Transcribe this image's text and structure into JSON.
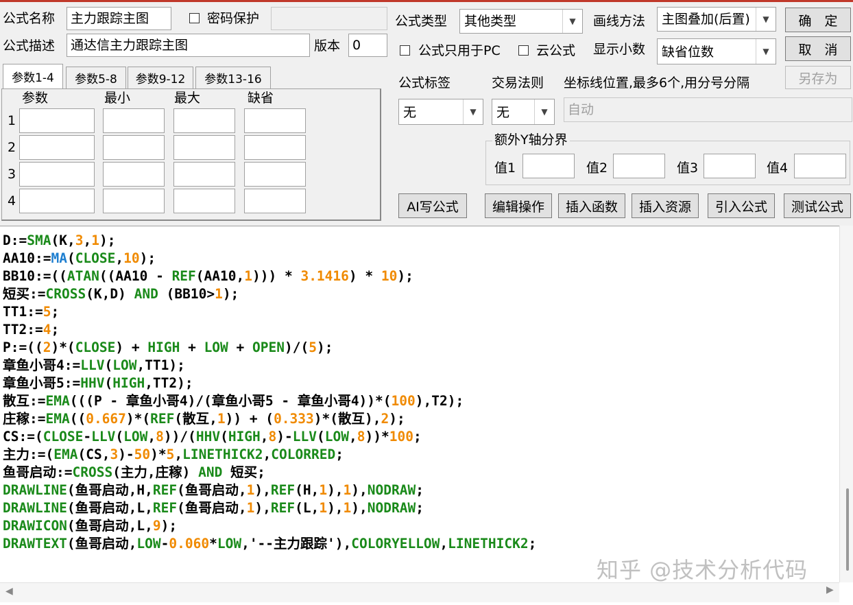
{
  "labels": {
    "formula_name": "公式名称",
    "password": "密码保护",
    "formula_desc": "公式描述",
    "version": "版本",
    "formula_type": "公式类型",
    "draw_method": "画线方法",
    "pc_only": "公式只用于PC",
    "cloud": "云公式",
    "show_decimal": "显示小数",
    "formula_tag": "公式标签",
    "trade_rule": "交易法则",
    "coord_lines": "坐标线位置,最多6个,用分号分隔",
    "extra_y": "额外Y轴分界",
    "v1": "值1",
    "v2": "值2",
    "v3": "值3",
    "v4": "值4"
  },
  "fields": {
    "formula_name": "主力跟踪主图",
    "password": "",
    "formula_desc": "通达信主力跟踪主图",
    "version": "0",
    "formula_type": "其他类型",
    "draw_method": "主图叠加(后置)",
    "show_decimal": "缺省位数",
    "formula_tag": "无",
    "trade_rule": "无",
    "coord_lines": "自动"
  },
  "buttons": {
    "ok": "确　定",
    "cancel": "取　消",
    "save_as": "另存为",
    "ai": "AI写公式",
    "edit": "编辑操作",
    "insert_func": "插入函数",
    "insert_res": "插入资源",
    "import": "引入公式",
    "test": "测试公式"
  },
  "tabs": [
    "参数1-4",
    "参数5-8",
    "参数9-12",
    "参数13-16"
  ],
  "param_headers": [
    "参数",
    "最小",
    "最大",
    "缺省"
  ],
  "param_rows": [
    "1",
    "2",
    "3",
    "4"
  ],
  "colors": {
    "green": "#1a8a1a",
    "orange": "#f08a00",
    "blue": "#1f7fd0",
    "black": "#000000"
  },
  "code_lines": [
    [
      [
        "D:=",
        "k"
      ],
      [
        "SMA",
        "g"
      ],
      [
        "(K,",
        "k"
      ],
      [
        "3",
        "o"
      ],
      [
        ",",
        "k"
      ],
      [
        "1",
        "o"
      ],
      [
        ");",
        "k"
      ]
    ],
    [
      [
        "AA10:=",
        "k"
      ],
      [
        "MA",
        "b"
      ],
      [
        "(",
        "k"
      ],
      [
        "CLOSE",
        "g"
      ],
      [
        ",",
        "k"
      ],
      [
        "10",
        "o"
      ],
      [
        ");",
        "k"
      ]
    ],
    [
      [
        "BB10:=((",
        "k"
      ],
      [
        "ATAN",
        "g"
      ],
      [
        "((AA10 - ",
        "k"
      ],
      [
        "REF",
        "g"
      ],
      [
        "(AA10,",
        "k"
      ],
      [
        "1",
        "o"
      ],
      [
        "))) * ",
        "k"
      ],
      [
        "3.1416",
        "o"
      ],
      [
        ") * ",
        "k"
      ],
      [
        "10",
        "o"
      ],
      [
        ");",
        "k"
      ]
    ],
    [
      [
        "短买:=",
        "k"
      ],
      [
        "CROSS",
        "g"
      ],
      [
        "(K,D) ",
        "k"
      ],
      [
        "AND",
        "g"
      ],
      [
        " (BB10>",
        "k"
      ],
      [
        "1",
        "o"
      ],
      [
        ");",
        "k"
      ]
    ],
    [
      [
        "TT1:=",
        "k"
      ],
      [
        "5",
        "o"
      ],
      [
        ";",
        "k"
      ]
    ],
    [
      [
        "TT2:=",
        "k"
      ],
      [
        "4",
        "o"
      ],
      [
        ";",
        "k"
      ]
    ],
    [
      [
        "P:=((",
        "k"
      ],
      [
        "2",
        "o"
      ],
      [
        ")*(",
        "k"
      ],
      [
        "CLOSE",
        "g"
      ],
      [
        ") + ",
        "k"
      ],
      [
        "HIGH",
        "g"
      ],
      [
        " + ",
        "k"
      ],
      [
        "LOW",
        "g"
      ],
      [
        " + ",
        "k"
      ],
      [
        "OPEN",
        "g"
      ],
      [
        ")/(",
        "k"
      ],
      [
        "5",
        "o"
      ],
      [
        ");",
        "k"
      ]
    ],
    [
      [
        "章鱼小哥4:=",
        "k"
      ],
      [
        "LLV",
        "g"
      ],
      [
        "(",
        "k"
      ],
      [
        "LOW",
        "g"
      ],
      [
        ",TT1);",
        "k"
      ]
    ],
    [
      [
        "章鱼小哥5:=",
        "k"
      ],
      [
        "HHV",
        "g"
      ],
      [
        "(",
        "k"
      ],
      [
        "HIGH",
        "g"
      ],
      [
        ",TT2);",
        "k"
      ]
    ],
    [
      [
        "散互:=",
        "k"
      ],
      [
        "EMA",
        "g"
      ],
      [
        "(((P - 章鱼小哥4)/(章鱼小哥5 - 章鱼小哥4))*(",
        "k"
      ],
      [
        "100",
        "o"
      ],
      [
        "),T2);",
        "k"
      ]
    ],
    [
      [
        "庄稼:=",
        "k"
      ],
      [
        "EMA",
        "g"
      ],
      [
        "((",
        "k"
      ],
      [
        "0.667",
        "o"
      ],
      [
        ")*(",
        "k"
      ],
      [
        "REF",
        "g"
      ],
      [
        "(散互,",
        "k"
      ],
      [
        "1",
        "o"
      ],
      [
        ")) + (",
        "k"
      ],
      [
        "0.333",
        "o"
      ],
      [
        ")*(散互),",
        "k"
      ],
      [
        "2",
        "o"
      ],
      [
        ");",
        "k"
      ]
    ],
    [
      [
        "CS:=(",
        "k"
      ],
      [
        "CLOSE",
        "g"
      ],
      [
        "-",
        "k"
      ],
      [
        "LLV",
        "g"
      ],
      [
        "(",
        "k"
      ],
      [
        "LOW",
        "g"
      ],
      [
        ",",
        "k"
      ],
      [
        "8",
        "o"
      ],
      [
        "))/(",
        "k"
      ],
      [
        "HHV",
        "g"
      ],
      [
        "(",
        "k"
      ],
      [
        "HIGH",
        "g"
      ],
      [
        ",",
        "k"
      ],
      [
        "8",
        "o"
      ],
      [
        ")-",
        "k"
      ],
      [
        "LLV",
        "g"
      ],
      [
        "(",
        "k"
      ],
      [
        "LOW",
        "g"
      ],
      [
        ",",
        "k"
      ],
      [
        "8",
        "o"
      ],
      [
        "))*",
        "k"
      ],
      [
        "100",
        "o"
      ],
      [
        ";",
        "k"
      ]
    ],
    [
      [
        "主力:=(",
        "k"
      ],
      [
        "EMA",
        "g"
      ],
      [
        "(CS,",
        "k"
      ],
      [
        "3",
        "o"
      ],
      [
        ")-",
        "k"
      ],
      [
        "50",
        "o"
      ],
      [
        ")*",
        "k"
      ],
      [
        "5",
        "o"
      ],
      [
        ",",
        "k"
      ],
      [
        "LINETHICK2",
        "g"
      ],
      [
        ",",
        "k"
      ],
      [
        "COLORRED",
        "g"
      ],
      [
        ";",
        "k"
      ]
    ],
    [
      [
        "鱼哥启动:=",
        "k"
      ],
      [
        "CROSS",
        "g"
      ],
      [
        "(主力,庄稼) ",
        "k"
      ],
      [
        "AND",
        "g"
      ],
      [
        " 短买;",
        "k"
      ]
    ],
    [
      [
        "DRAWLINE",
        "g"
      ],
      [
        "(鱼哥启动,H,",
        "k"
      ],
      [
        "REF",
        "g"
      ],
      [
        "(鱼哥启动,",
        "k"
      ],
      [
        "1",
        "o"
      ],
      [
        "),",
        "k"
      ],
      [
        "REF",
        "g"
      ],
      [
        "(H,",
        "k"
      ],
      [
        "1",
        "o"
      ],
      [
        "),",
        "k"
      ],
      [
        "1",
        "o"
      ],
      [
        "),",
        "k"
      ],
      [
        "NODRAW",
        "g"
      ],
      [
        ";",
        "k"
      ]
    ],
    [
      [
        "DRAWLINE",
        "g"
      ],
      [
        "(鱼哥启动,L,",
        "k"
      ],
      [
        "REF",
        "g"
      ],
      [
        "(鱼哥启动,",
        "k"
      ],
      [
        "1",
        "o"
      ],
      [
        "),",
        "k"
      ],
      [
        "REF",
        "g"
      ],
      [
        "(L,",
        "k"
      ],
      [
        "1",
        "o"
      ],
      [
        "),",
        "k"
      ],
      [
        "1",
        "o"
      ],
      [
        "),",
        "k"
      ],
      [
        "NODRAW",
        "g"
      ],
      [
        ";",
        "k"
      ]
    ],
    [
      [
        "DRAWICON",
        "g"
      ],
      [
        "(鱼哥启动,L,",
        "k"
      ],
      [
        "9",
        "o"
      ],
      [
        ");",
        "k"
      ]
    ],
    [
      [
        "DRAWTEXT",
        "g"
      ],
      [
        "(鱼哥启动,",
        "k"
      ],
      [
        "LOW",
        "g"
      ],
      [
        "-",
        "k"
      ],
      [
        "0.060",
        "o"
      ],
      [
        "*",
        "k"
      ],
      [
        "LOW",
        "g"
      ],
      [
        ",'--主力跟踪'),",
        "k"
      ],
      [
        "COLORYELLOW",
        "g"
      ],
      [
        ",",
        "k"
      ],
      [
        "LINETHICK2",
        "g"
      ],
      [
        ";",
        "k"
      ]
    ]
  ],
  "watermark": "知乎 @技术分析代码"
}
